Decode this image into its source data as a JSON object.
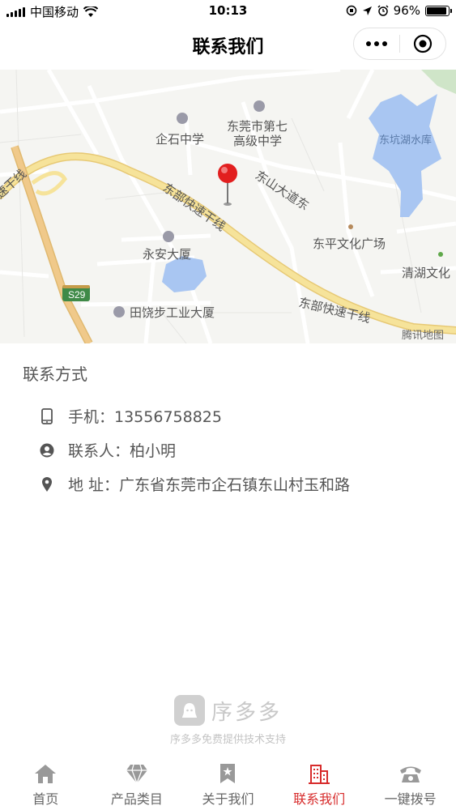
{
  "status_bar": {
    "carrier": "中国移动",
    "time": "10:13",
    "battery": "96%"
  },
  "nav": {
    "title": "联系我们"
  },
  "map": {
    "labels": {
      "qishi_middle": "企石中学",
      "dongguan7_line1": "东莞市第七",
      "dongguan7_line2": "高级中学",
      "dongkeng_reservoir": "东坑湖水库",
      "east_expressway_1": "东部快速干线",
      "dongshan_avenue": "东山大道东",
      "dongping_square": "东平文化广场",
      "yongan_building": "永安大厦",
      "qinghu_culture": "清湖文化",
      "s29": "S29",
      "tianrao_building": "田饶步工业大厦",
      "east_expressway_2": "东部快速干线",
      "left_expressway": "速干线",
      "tencent": "腾讯地图"
    }
  },
  "contact": {
    "title": "联系方式",
    "phone": "手机：13556758825",
    "person": "联系人：柏小明",
    "address": "地 址：广东省东莞市企石镇东山村玉和路"
  },
  "footer": {
    "brand": "序多多",
    "support": "序多多免费提供技术支持"
  },
  "tabs": [
    {
      "label": "首页",
      "icon": "home-icon"
    },
    {
      "label": "产品类目",
      "icon": "diamond-icon"
    },
    {
      "label": "关于我们",
      "icon": "bookmark-star-icon"
    },
    {
      "label": "联系我们",
      "icon": "building-icon"
    },
    {
      "label": "一键拨号",
      "icon": "phone-icon"
    }
  ],
  "colors": {
    "accent": "#d72b2b",
    "tab_inactive": "#999999",
    "road_major": "#f3dd8f",
    "water": "#a9c6f2"
  }
}
